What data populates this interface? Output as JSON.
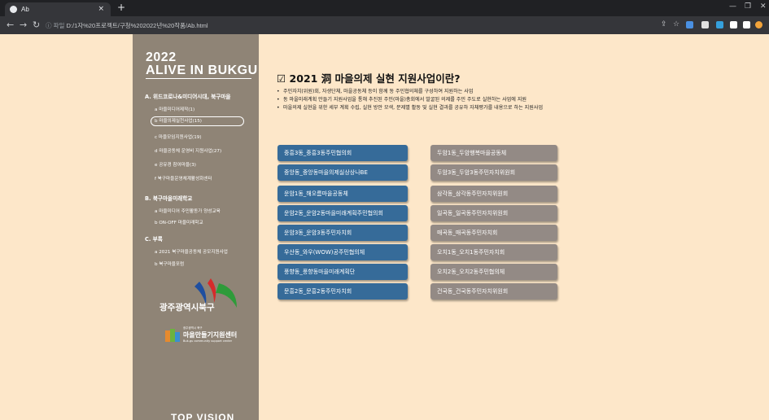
{
  "browser": {
    "tab_title": "Ab",
    "tab_close": "×",
    "new_tab": "+",
    "url_scheme": "ⓘ 파일",
    "url": "D:/1자%20프로젝트/구청%202022년%20작품/Ab.html",
    "window_min": "—",
    "window_max": "❐",
    "window_close": "✕"
  },
  "sidebar": {
    "year": "2022",
    "brand": "ALIVE IN BUKGU",
    "sections": [
      {
        "label": "A. 위드코로나&미디어시대, 북구마을",
        "items": [
          "a 마을미디어제작(1)",
          "b 마을의제실천사업(15)",
          "c 마을모임지원사업(19)",
          "d 마을공동체 운영비 지원사업(27)",
          "e 공유경 참여마을(3)",
          "f 북구마을운영체계활성화센터"
        ]
      },
      {
        "label": "B. 북구마을미래학교",
        "items": [
          "a 마을미디어 주민활동가 양성교육",
          "b ON-OFF 마을미래학교"
        ]
      },
      {
        "label": "C. 부록",
        "items": [
          "a 2021 북구마을공동체 공모지원사업",
          "b 북구마을포럼"
        ]
      }
    ],
    "org_name": "광주광역시북구",
    "center_small": "광주광역시 북구",
    "center_name": "마을만들기지원센터",
    "center_eng": "Buk-gu community support center",
    "footer_brand": "TOP VISION"
  },
  "main": {
    "title": "☑ 2021 洞 마을의제 실현 지원사업이란?",
    "bullets": [
      "주민자치(위원)회, 자생단체, 마을공동체 등이 함께 동 주민협의체를 구성하여 지원하는 사업",
      "동 마을미래계획 만들기 지원사업을 통해 추진된 주민(마을)총회에서 발굴된 의제를 주민 주도로 실현하는 사업에 지원",
      "마을의제 실현을 위한 세부 계획 수립, 실현 방안 모색, 문제별 활동 및 실현 결과를 공유하 자체평가를 내용으로 하는 지원사업"
    ],
    "left_buttons": [
      "중흥3동_중흥3동주민협의회",
      "중앙동_중앙동마을의제실상상나BE",
      "운암1동_해오름마을공동체",
      "운암2동_운암2동마을미래계획주민협의회",
      "운암3동_운암3동주민자치회",
      "우산동_와우(WOW)공주민협의체",
      "풍향동_풍향동마을미래계획단",
      "문흥2동_문흥2동주민자치회"
    ],
    "right_buttons": [
      "두암1동_두암행복마을공동체",
      "두암3동_두암3동주민자치위원회",
      "삼각동_삼각동주민자치위원회",
      "일곡동_일곡동주민자치위원회",
      "매곡동_매곡동주민자치회",
      "오치1동_오치1동주민자치회",
      "오치2동_오치2동주민협의체",
      "건국동_건국동주민자치위원회"
    ]
  },
  "colors": {
    "page_bg": "#fde7c9",
    "sidebar_bg": "#8f8476",
    "blue_button": "#366b99",
    "gray_button": "#938a85"
  }
}
